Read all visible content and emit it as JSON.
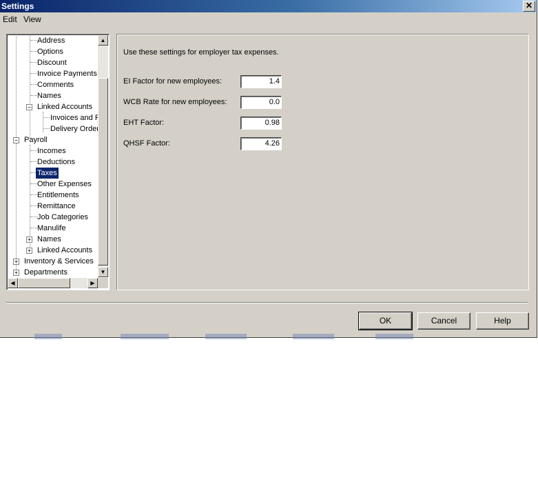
{
  "window": {
    "title": "Settings",
    "close_glyph": "✕"
  },
  "menu": [
    "Edit",
    "View"
  ],
  "tree": {
    "items": [
      {
        "label": "Address",
        "selected": false
      },
      {
        "label": "Options",
        "selected": false
      },
      {
        "label": "Discount",
        "selected": false
      },
      {
        "label": "Invoice Payments",
        "selected": false
      },
      {
        "label": "Comments",
        "selected": false
      },
      {
        "label": "Names",
        "selected": false
      },
      {
        "label": "Linked Accounts",
        "selected": false,
        "expander": "−"
      },
      {
        "label": "Invoices and F",
        "selected": false
      },
      {
        "label": "Delivery Order",
        "selected": false
      },
      {
        "label": "Payroll",
        "selected": false,
        "expander": "−"
      },
      {
        "label": "Incomes",
        "selected": false
      },
      {
        "label": "Deductions",
        "selected": false
      },
      {
        "label": "Taxes",
        "selected": true
      },
      {
        "label": "Other Expenses",
        "selected": false
      },
      {
        "label": "Entitlements",
        "selected": false
      },
      {
        "label": "Remittance",
        "selected": false
      },
      {
        "label": "Job Categories",
        "selected": false
      },
      {
        "label": "Manulife",
        "selected": false
      },
      {
        "label": "Names",
        "selected": false,
        "expander": "+"
      },
      {
        "label": "Linked Accounts",
        "selected": false,
        "expander": "+"
      },
      {
        "label": "Inventory & Services",
        "selected": false,
        "expander": "+"
      },
      {
        "label": "Departments",
        "selected": false,
        "expander": "+"
      }
    ]
  },
  "panel": {
    "intro": "Use these settings for employer tax expenses.",
    "fields": [
      {
        "label": "EI Factor for new employees:",
        "value": "1.4"
      },
      {
        "label": "WCB Rate for new employees:",
        "value": "0.0"
      },
      {
        "label": "EHT Factor:",
        "value": "0.98"
      },
      {
        "label": "QHSF Factor:",
        "value": "4.26"
      }
    ]
  },
  "buttons": {
    "ok": "OK",
    "cancel": "Cancel",
    "help": "Help"
  },
  "colors": {
    "face": "#d4d0c8",
    "title_start": "#0a246a",
    "title_end": "#a6caf0",
    "selection": "#0a246a"
  }
}
